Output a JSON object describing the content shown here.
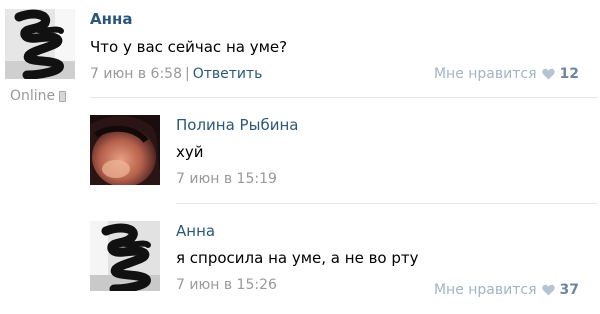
{
  "post": {
    "author": "Анна",
    "text": "Что у вас сейчас на уме?",
    "date": "7 июн в 6:58",
    "separator": "|",
    "reply_label": "Ответить",
    "like_label": "Мне нравится",
    "like_count": "12",
    "online_status": "Online"
  },
  "comments": [
    {
      "author": "Полина Рыбина",
      "text": "хуй",
      "date": "7 июн в 15:19"
    },
    {
      "author": "Анна",
      "text": "я спросила на уме, а не во рту",
      "date": "7 июн в 15:26",
      "like_label": "Мне нравится",
      "like_count": "37"
    }
  ],
  "colors": {
    "link": "#2b587a",
    "meta": "#999999",
    "like": "#a2b4c6",
    "divider": "#e4e8ec"
  },
  "icons": {
    "heart": "heart-icon",
    "phone": "mobile-phone-icon"
  }
}
